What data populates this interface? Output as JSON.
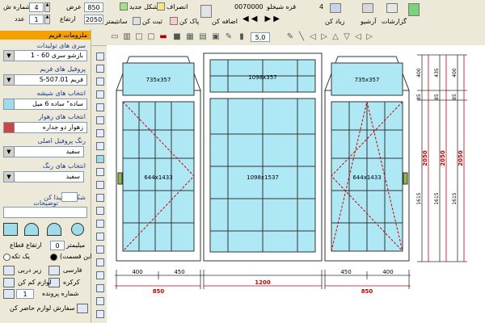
{
  "toolbar": {
    "row1": {
      "window_number_label": "شماره ش",
      "window_number_value": "4",
      "width_label": "عرض",
      "width_value": "850",
      "height_label": "ارتفاع",
      "height_value": "2050",
      "count_label": "عدد",
      "count_value": "1",
      "new_shape_label": "شکل جدید",
      "cancel_label": "انصراف",
      "mosque_label": "قره شیخلو",
      "code_value": "0070000",
      "number_value": "4"
    },
    "row1b": {
      "cm_label": "سانتيمتر",
      "register_label": "ثبت کن",
      "clear_label": "پاک کن",
      "add_label": "اضافه کن",
      "zoom_label": "زیاد کن",
      "archive_label": "آرشیو",
      "reports_label": "گزارشات"
    },
    "zoom_value": "5,0"
  },
  "sidebar": {
    "header": "ملزومات فریم",
    "profile_series_label": "سری های تولیدات",
    "profile_series_value": "بازشو سری 60 - 1",
    "frame_profile_label": "پروفیل های فریم",
    "frame_profile_value": "S-507.01 فریم",
    "glass_label": "انتخاب های شیشه",
    "glass_value": "ساده\" ساده 6 میل",
    "mullion_label": "انتخاب های زهوار",
    "mullion_value": "زهوار دو جداره",
    "color_label": "رنگ پروفیل اصلی",
    "color_value": "سفید",
    "color2_label": "انتخاب های رنگ",
    "color2_value": "سفید",
    "shape_label": "شکل را پیدا کن",
    "notes_label": "توضیحات",
    "arch_height_label": "ارتفاع قطاع",
    "arch_height_value": "0",
    "mm_label": "میلیمتر",
    "one_piece_label": "یک تکه",
    "split_label": "(این قسمت",
    "frame_label": "فارسی",
    "sash_label": "زیر دربی",
    "tools_label": "لوازم کم کن",
    "grill_label": "کرکره",
    "file_number_label": "شماره پرونده",
    "file_number_value": "1",
    "order_label": "سفارش لوازم حاضر کن"
  },
  "chart_data": {
    "type": "diagram",
    "panels": [
      {
        "name": "top-left",
        "label": "735x357"
      },
      {
        "name": "top-middle",
        "label": "1098x357"
      },
      {
        "name": "top-right",
        "label": "735x357"
      },
      {
        "name": "left-sash",
        "label": "644x1433"
      },
      {
        "name": "center",
        "label": "1098x1537"
      },
      {
        "name": "right-sash",
        "label": "644x1433"
      }
    ],
    "bottom_dims": [
      "400",
      "450",
      "850",
      "1200",
      "450",
      "400",
      "850"
    ],
    "right_dims": [
      "400",
      "435",
      "400",
      "85",
      "1615",
      "1615",
      "1615",
      "2050",
      "2050",
      "2050",
      "85",
      "85"
    ]
  }
}
